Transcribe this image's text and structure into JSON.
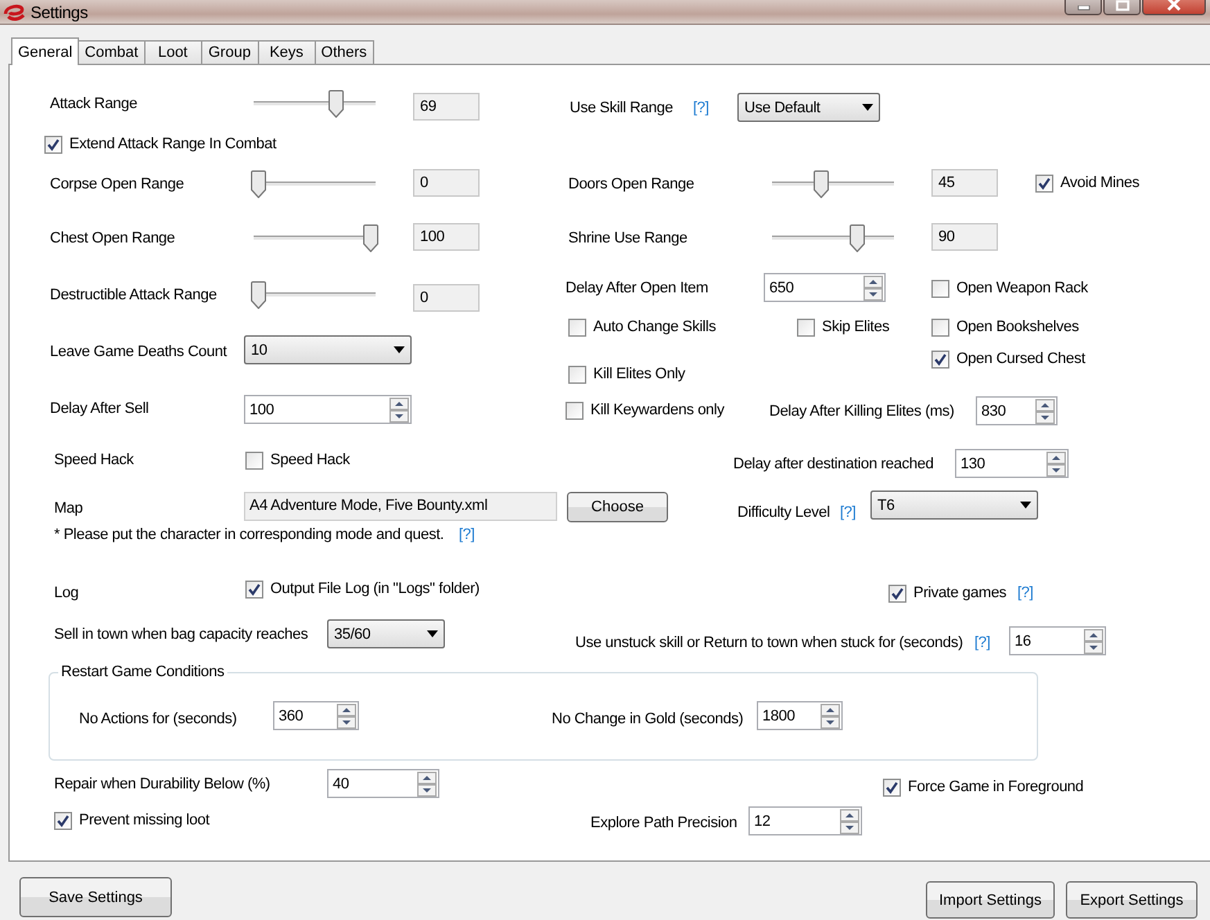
{
  "window": {
    "title": "Settings"
  },
  "tabs": [
    {
      "label": "General",
      "selected": true
    },
    {
      "label": "Combat",
      "selected": false
    },
    {
      "label": "Loot",
      "selected": false
    },
    {
      "label": "Group",
      "selected": false
    },
    {
      "label": "Keys",
      "selected": false
    },
    {
      "label": "Others",
      "selected": false
    }
  ],
  "controls": [
    {
      "kind": "label",
      "text": "Attack Range"
    },
    {
      "kind": "slider",
      "level": 0.69
    },
    {
      "kind": "readout",
      "value": "69"
    },
    {
      "kind": "label",
      "text": "Use Skill Range"
    },
    {
      "kind": "help",
      "text": "[?]"
    },
    {
      "kind": "combo",
      "value": "Use Default"
    },
    {
      "kind": "checkbox",
      "label": "Extend Attack Range In Combat",
      "checked": true
    },
    {
      "kind": "label",
      "text": "Corpse Open Range"
    },
    {
      "kind": "slider",
      "level": 0
    },
    {
      "kind": "readout",
      "value": "0"
    },
    {
      "kind": "label",
      "text": "Doors Open Range"
    },
    {
      "kind": "slider",
      "level": 0.4
    },
    {
      "kind": "readout",
      "value": "45"
    },
    {
      "kind": "checkbox",
      "label": "Avoid Mines",
      "checked": true
    },
    {
      "kind": "label",
      "text": "Chest Open Range"
    },
    {
      "kind": "slider",
      "level": 1
    },
    {
      "kind": "readout",
      "value": "100"
    },
    {
      "kind": "label",
      "text": "Shrine Use Range"
    },
    {
      "kind": "slider",
      "level": 0.72
    },
    {
      "kind": "readout",
      "value": "90"
    },
    {
      "kind": "label",
      "text": "Destructible Attack Range"
    },
    {
      "kind": "slider",
      "level": 0
    },
    {
      "kind": "readout",
      "value": "0"
    },
    {
      "kind": "label",
      "text": "Delay After Open Item"
    },
    {
      "kind": "spin",
      "value": "650"
    },
    {
      "kind": "checkbox",
      "label": "Open Weapon Rack",
      "checked": false
    },
    {
      "kind": "checkbox",
      "label": "Auto Change Skills",
      "checked": false
    },
    {
      "kind": "checkbox",
      "label": "Skip Elites",
      "checked": false
    },
    {
      "kind": "checkbox",
      "label": "Open Bookshelves",
      "checked": false
    },
    {
      "kind": "checkbox",
      "label": "Open Cursed Chest",
      "checked": true
    },
    {
      "kind": "label",
      "text": "Leave Game Deaths Count"
    },
    {
      "kind": "combo",
      "value": "10"
    },
    {
      "kind": "checkbox",
      "label": "Kill Elites Only",
      "checked": false
    },
    {
      "kind": "label",
      "text": "Delay After Sell"
    },
    {
      "kind": "spin",
      "value": "100"
    },
    {
      "kind": "checkbox",
      "label": "Kill Keywardens only",
      "checked": false
    },
    {
      "kind": "label",
      "text": "Delay After Killing Elites (ms)"
    },
    {
      "kind": "spin",
      "value": "830"
    },
    {
      "kind": "label",
      "text": "Speed Hack"
    },
    {
      "kind": "checkbox",
      "label": "Speed Hack",
      "checked": false
    },
    {
      "kind": "label",
      "text": "Delay after destination reached"
    },
    {
      "kind": "spin",
      "value": "130"
    },
    {
      "kind": "label",
      "text": "Map"
    },
    {
      "kind": "textbox",
      "value": "A4 Adventure Mode, Five Bounty.xml"
    },
    {
      "kind": "button",
      "label": "Choose"
    },
    {
      "kind": "label",
      "text": "Difficulty Level"
    },
    {
      "kind": "help",
      "text": "[?]"
    },
    {
      "kind": "combo",
      "value": "T6"
    },
    {
      "kind": "label",
      "text": "* Please put the character in corresponding mode and quest."
    },
    {
      "kind": "help",
      "text": "[?]"
    },
    {
      "kind": "label",
      "text": "Log"
    },
    {
      "kind": "checkbox",
      "label": "Output File Log (in \"Logs\" folder)",
      "checked": true
    },
    {
      "kind": "checkbox",
      "label": "Private games",
      "checked": true
    },
    {
      "kind": "help",
      "text": "[?]"
    },
    {
      "kind": "label",
      "text": "Sell in town when bag capacity reaches"
    },
    {
      "kind": "combo",
      "value": "35/60"
    },
    {
      "kind": "label",
      "text": "Use unstuck skill or Return to town when stuck for (seconds)"
    },
    {
      "kind": "help",
      "text": "[?]"
    },
    {
      "kind": "spin",
      "value": "16"
    },
    {
      "kind": "group",
      "title": "Restart Game Conditions"
    },
    {
      "kind": "label",
      "text": "No Actions for (seconds)"
    },
    {
      "kind": "spin",
      "value": "360"
    },
    {
      "kind": "label",
      "text": "No Change in Gold (seconds)"
    },
    {
      "kind": "spin",
      "value": "1800"
    },
    {
      "kind": "label",
      "text": "Repair when Durability Below (%)"
    },
    {
      "kind": "spin",
      "value": "40"
    },
    {
      "kind": "checkbox",
      "label": "Force Game in Foreground",
      "checked": true
    },
    {
      "kind": "checkbox",
      "label": "Prevent missing loot",
      "checked": true
    },
    {
      "kind": "label",
      "text": "Explore Path Precision"
    },
    {
      "kind": "spin",
      "value": "12"
    }
  ],
  "buttons": [
    {
      "label": "Save Settings"
    },
    {
      "label": "Import Settings"
    },
    {
      "label": "Export Settings"
    }
  ]
}
